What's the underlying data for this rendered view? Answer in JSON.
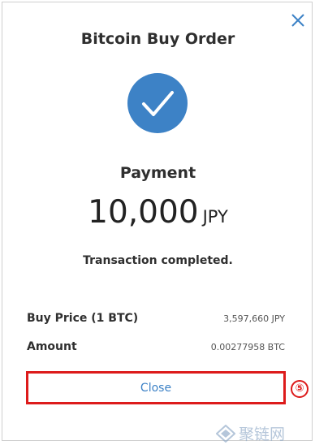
{
  "dialog": {
    "title": "Bitcoin Buy Order",
    "payment_label": "Payment",
    "amount_value": "10,000",
    "amount_currency": "JPY",
    "status": "Transaction completed.",
    "rows": [
      {
        "label": "Buy Price (1 BTC)",
        "value": "3,597,660 JPY"
      },
      {
        "label": "Amount",
        "value": "0.00277958 BTC"
      }
    ],
    "close_button_label": "Close",
    "close_icon": "close-icon",
    "check_icon": "checkmark-icon"
  },
  "annotation": {
    "step_number": "⑤",
    "highlight_color": "#dd1b1b"
  },
  "watermark": {
    "text": "聚链网"
  },
  "colors": {
    "accent": "#3d82c6",
    "text": "#2f2f2f",
    "highlight": "#dd1b1b"
  }
}
